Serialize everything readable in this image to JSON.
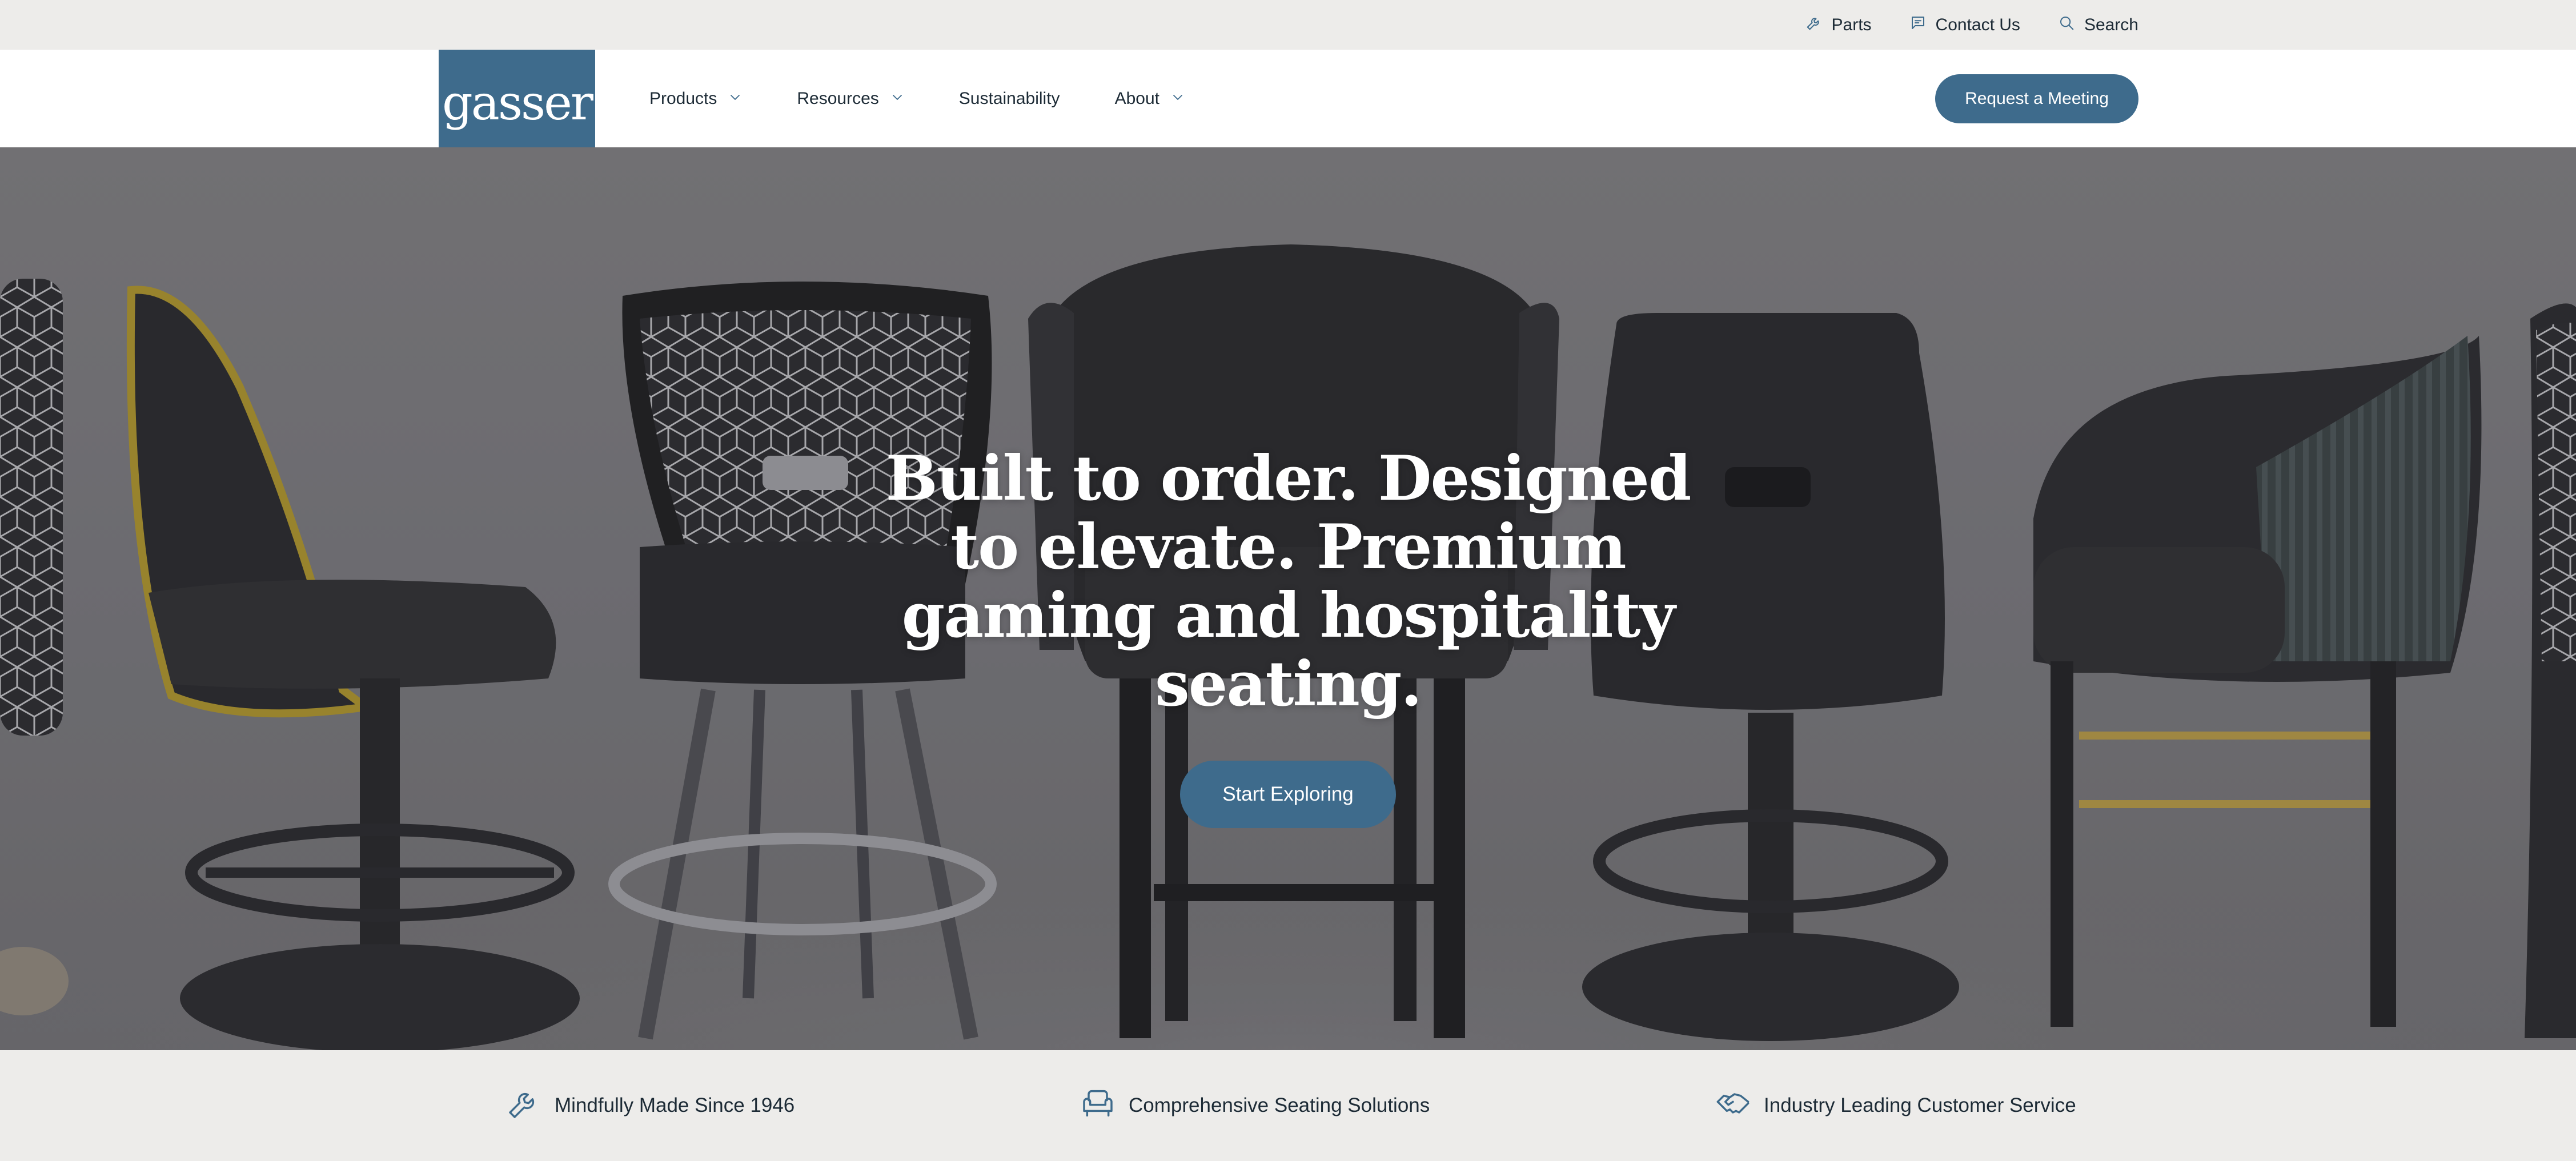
{
  "utility": {
    "links": [
      {
        "label": "Parts",
        "icon": "wrench-icon"
      },
      {
        "label": "Contact Us",
        "icon": "chat-icon"
      },
      {
        "label": "Search",
        "icon": "search-icon"
      }
    ]
  },
  "header": {
    "logo_text": "gasser",
    "nav": [
      {
        "label": "Products",
        "has_dropdown": true
      },
      {
        "label": "Resources",
        "has_dropdown": true
      },
      {
        "label": "Sustainability",
        "has_dropdown": false
      },
      {
        "label": "About",
        "has_dropdown": true
      }
    ],
    "cta_label": "Request a Meeting"
  },
  "hero": {
    "title": "Built to order. Designed to elevate. Premium gaming and hospitality seating.",
    "button_label": "Start Exploring"
  },
  "features": [
    {
      "label": "Mindfully Made Since 1946",
      "icon": "wrench-icon"
    },
    {
      "label": "Comprehensive Seating Solutions",
      "icon": "armchair-icon"
    },
    {
      "label": "Industry Leading Customer Service",
      "icon": "handshake-icon"
    }
  ],
  "colors": {
    "brand": "#3e6b8c",
    "utility_bg": "#edecea",
    "text": "#1d2b36"
  }
}
